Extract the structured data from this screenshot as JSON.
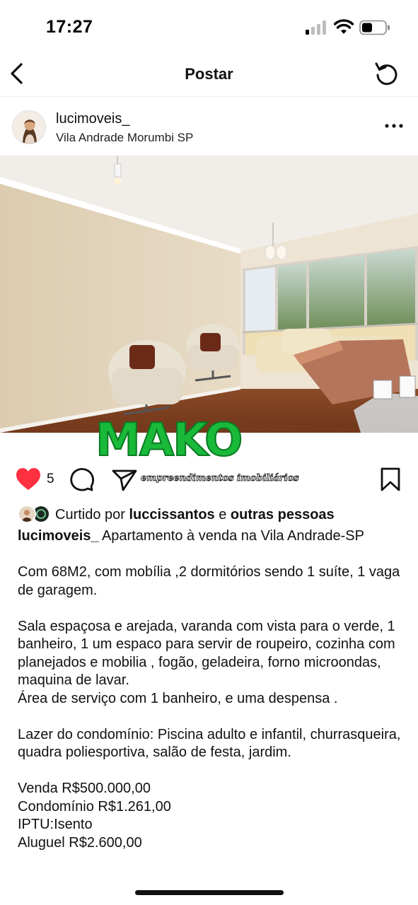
{
  "status_bar": {
    "time": "17:27",
    "icons": [
      "cellular-signal-icon",
      "wifi-icon",
      "battery-icon"
    ]
  },
  "header": {
    "title": "Postar",
    "back_icon": "chevron-left-icon",
    "refresh_icon": "refresh-icon"
  },
  "post": {
    "username": "lucimoveis_",
    "location": "Vila Andrade Morumbi SP",
    "more_icon": "more-horizontal-icon",
    "watermark": {
      "brand": "MAKO",
      "tagline": "empreendimentos imobiliários"
    },
    "likes_count": "5",
    "liked_by": {
      "prefix": "Curtido por",
      "user": "luccissantos",
      "connector": "e",
      "others": "outras pessoas"
    },
    "caption": {
      "user": "lucimoveis_",
      "headline": "Apartamento à venda na Vila Andrade-SP",
      "p1": "Com 68M2, com mobília ,2 dormitórios sendo 1 suíte, 1 vaga de garagem.",
      "p2a": "Sala espaçosa e arejada, varanda com vista para o verde, 1 banheiro, 1 um espaco para servir de roupeiro, cozinha com  planejados e mobilia , fogão, geladeira, forno microondas, maquina de lavar.",
      "p2b": "Área de serviço com 1 banheiro, e uma despensa .",
      "p3": "Lazer do condomínio: Piscina adulto e infantil, churrasqueira, quadra poliesportiva, salão de festa, jardim.",
      "price_sale": "Venda R$500.000,00",
      "price_condo": "Condomínio R$1.261,00",
      "price_iptu": "IPTU:Isento",
      "price_rent": "Aluguel R$2.600,00"
    }
  },
  "colors": {
    "like_red": "#ff3040",
    "watermark_green": "#19b93a"
  }
}
